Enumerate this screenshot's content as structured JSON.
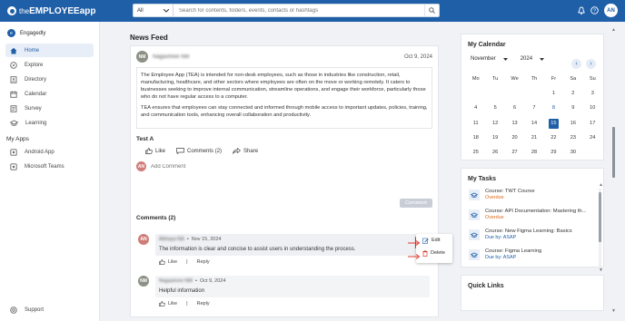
{
  "app": {
    "brand_the": "the",
    "brand_rest": "EMPLOYEEapp"
  },
  "search": {
    "filter": "All",
    "placeholder": "Search for contents, folders, events, contacts or hashtags"
  },
  "user": {
    "initials": "AN"
  },
  "sidebar": {
    "workspace": "Engagedly",
    "items": [
      {
        "label": "Home",
        "icon": "home-icon"
      },
      {
        "label": "Explore",
        "icon": "compass-icon"
      },
      {
        "label": "Directory",
        "icon": "directory-icon"
      },
      {
        "label": "Calendar",
        "icon": "calendar-icon"
      },
      {
        "label": "Survey",
        "icon": "survey-icon"
      },
      {
        "label": "Learning",
        "icon": "learning-icon"
      }
    ],
    "my_apps_title": "My Apps",
    "apps": [
      {
        "label": "Android App"
      },
      {
        "label": "Microsoft Teams"
      }
    ],
    "support": "Support"
  },
  "feed": {
    "title": "News Feed",
    "post": {
      "initials": "NM",
      "author": "Nagashree NM",
      "date": "Oct 9, 2024",
      "p1": "The Employee App (TEA) is intended for non-desk employees, such as those in industries like construction, retail, manufacturing, healthcare, and other sectors where employees are often on the move or working remotely. It caters to businesses seeking to improve internal communication, streamline operations, and engage their workforce, particularly those who do not have regular access to a computer.",
      "p2": "TEA ensures that employees can stay connected and informed through mobile access to important updates, policies, training, and communication tools, enhancing overall collaboration and productivity.",
      "title": "Test A",
      "like": "Like",
      "comments": "Comments (2)",
      "share": "Share",
      "add_comment_placeholder": "Add Comment",
      "comment_button": "Comment"
    },
    "comments_title": "Comments (2)",
    "comments": [
      {
        "initials": "AN",
        "author": "Abhaya NA",
        "date": "Nov 15, 2024",
        "text": "The information is clear and concise to assist users in understanding the process.",
        "like": "Like",
        "reply": "Reply"
      },
      {
        "initials": "NM",
        "author": "Nagashree NM",
        "date": "Oct 9, 2024",
        "text": "Helpful information",
        "like": "Like",
        "reply": "Reply"
      }
    ],
    "menu": {
      "edit": "Edit",
      "delete": "Delete"
    }
  },
  "calendar": {
    "title": "My Calendar",
    "month": "November",
    "year": "2024",
    "weekdays": [
      "Mo",
      "Tu",
      "We",
      "Th",
      "Fr",
      "Sa",
      "Su"
    ],
    "days": [
      "",
      "",
      "",
      "",
      "1",
      "2",
      "3",
      "4",
      "5",
      "6",
      "7",
      "8",
      "9",
      "10",
      "11",
      "12",
      "13",
      "14",
      "15",
      "16",
      "17",
      "18",
      "19",
      "20",
      "21",
      "22",
      "23",
      "24",
      "25",
      "26",
      "27",
      "28",
      "29",
      "30",
      ""
    ],
    "today": "15",
    "highlighted": "8"
  },
  "tasks": {
    "title": "My Tasks",
    "items": [
      {
        "name": "Course: TWT Course",
        "sub": "Overdue",
        "status": "overdue"
      },
      {
        "name": "Course: API Documentation: Mastering th...",
        "sub": "Overdue",
        "status": "overdue"
      },
      {
        "name": "Course: New Figma Learning: Basics",
        "sub": "Due by: ASAP",
        "status": "due"
      },
      {
        "name": "Course: Figma Learning",
        "sub": "Due by: ASAP",
        "status": "due"
      }
    ]
  },
  "quick_links": {
    "title": "Quick Links"
  },
  "colors": {
    "brand": "#1f5fa8",
    "highlight": "#e0392d",
    "overdue": "#e06b1f"
  }
}
